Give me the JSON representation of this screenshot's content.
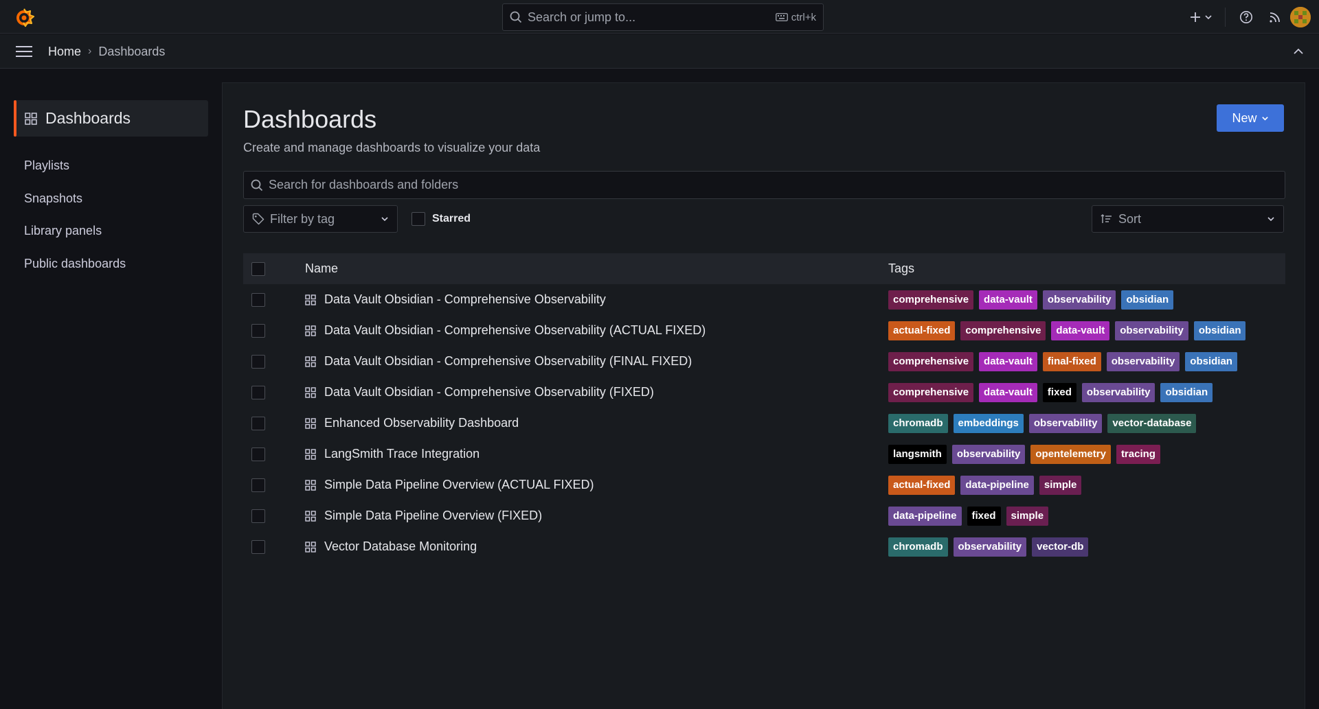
{
  "topbar": {
    "search_placeholder": "Search or jump to...",
    "shortcut": "ctrl+k"
  },
  "breadcrumb": {
    "home": "Home",
    "separator": "›",
    "current": "Dashboards"
  },
  "sidebar": {
    "active": "Dashboards",
    "items": [
      {
        "label": "Playlists"
      },
      {
        "label": "Snapshots"
      },
      {
        "label": "Library panels"
      },
      {
        "label": "Public dashboards"
      }
    ]
  },
  "main": {
    "title": "Dashboards",
    "subtitle": "Create and manage dashboards to visualize your data",
    "new_button": "New",
    "search_placeholder": "Search for dashboards and folders",
    "filter_placeholder": "Filter by tag",
    "starred_label": "Starred",
    "sort_placeholder": "Sort",
    "columns": {
      "name": "Name",
      "tags": "Tags"
    }
  },
  "tag_colors": {
    "comprehensive": "#6e1f4b",
    "data-vault": "#a52bb8",
    "observability": "#6a4a93",
    "obsidian": "#3a73b8",
    "actual-fixed": "#c9591a",
    "final-fixed": "#c2571b",
    "fixed": "#000000",
    "chromadb": "#2a6b6b",
    "embeddings": "#2d7dbd",
    "vector-database": "#2c5a4e",
    "langsmith": "#000000",
    "opentelemetry": "#c05f16",
    "tracing": "#7b1e52",
    "data-pipeline": "#6a4a93",
    "simple": "#6a1f51",
    "vector-db": "#4a3770"
  },
  "rows": [
    {
      "name": "Data Vault Obsidian - Comprehensive Observability",
      "tags": [
        "comprehensive",
        "data-vault",
        "observability",
        "obsidian"
      ]
    },
    {
      "name": "Data Vault Obsidian - Comprehensive Observability (ACTUAL FIXED)",
      "tags": [
        "actual-fixed",
        "comprehensive",
        "data-vault",
        "observability",
        "obsidian"
      ]
    },
    {
      "name": "Data Vault Obsidian - Comprehensive Observability (FINAL FIXED)",
      "tags": [
        "comprehensive",
        "data-vault",
        "final-fixed",
        "observability",
        "obsidian"
      ]
    },
    {
      "name": "Data Vault Obsidian - Comprehensive Observability (FIXED)",
      "tags": [
        "comprehensive",
        "data-vault",
        "fixed",
        "observability",
        "obsidian"
      ]
    },
    {
      "name": "Enhanced Observability Dashboard",
      "tags": [
        "chromadb",
        "embeddings",
        "observability",
        "vector-database"
      ]
    },
    {
      "name": "LangSmith Trace Integration",
      "tags": [
        "langsmith",
        "observability",
        "opentelemetry",
        "tracing"
      ]
    },
    {
      "name": "Simple Data Pipeline Overview (ACTUAL FIXED)",
      "tags": [
        "actual-fixed",
        "data-pipeline",
        "simple"
      ]
    },
    {
      "name": "Simple Data Pipeline Overview (FIXED)",
      "tags": [
        "data-pipeline",
        "fixed",
        "simple"
      ]
    },
    {
      "name": "Vector Database Monitoring",
      "tags": [
        "chromadb",
        "observability",
        "vector-db"
      ]
    }
  ]
}
